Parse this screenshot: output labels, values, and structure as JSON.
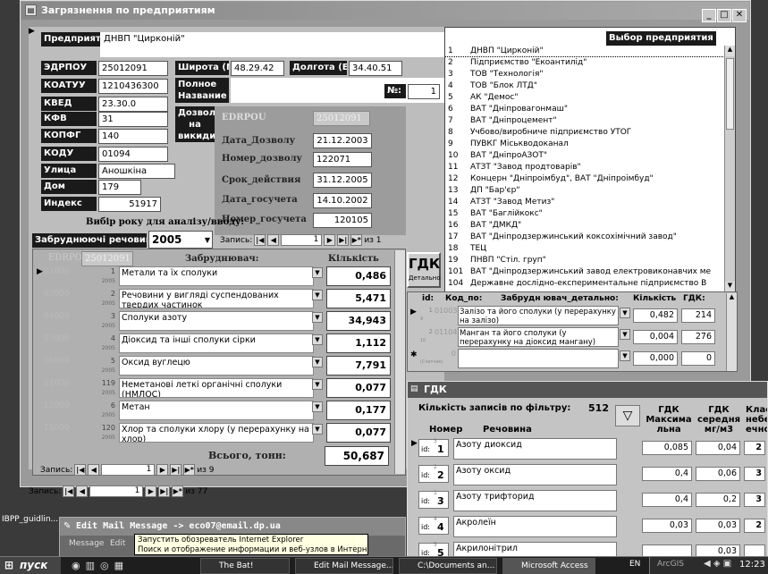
{
  "main_window": {
    "title": "Загрязнення по предприятиям"
  },
  "enterprise": {
    "label": "Предприятие",
    "value": "ДНВП \"Цирконій\""
  },
  "fields": {
    "edrpou": {
      "label": "ЭДРПОУ",
      "value": "25012091"
    },
    "koatuu": {
      "label": "КОАТУУ",
      "value": "1210436300"
    },
    "kved": {
      "label": "КВЕД",
      "value": "23.30.0"
    },
    "kfv": {
      "label": "КФВ",
      "value": "31"
    },
    "kopfg": {
      "label": "КОПФГ",
      "value": "140"
    },
    "kodu": {
      "label": "КОДУ",
      "value": "01094"
    },
    "street": {
      "label": "Улица",
      "value": "Аношкіна"
    },
    "house": {
      "label": "Дом",
      "value": "179"
    },
    "index": {
      "label": "Индекс",
      "value": "51917"
    },
    "lat": {
      "label": "Широта (N)",
      "value": "48.29.42"
    },
    "lon": {
      "label": "Долгота (E)",
      "value": "34.40.51"
    },
    "full_name": {
      "label": "Полное Название",
      "value": ""
    },
    "num": {
      "label": "№:",
      "value": "1"
    }
  },
  "permits": {
    "label": "Дозволи на викиди",
    "edrpou_label": "EDRPOU",
    "edrpou_value": "25012091",
    "date_label": "Дата_Дозволу",
    "date_value": "21.12.2003",
    "num_label": "Номер_дозволу",
    "num_value": "122071",
    "term_label": "Срок_действия",
    "term_value": "31.12.2005",
    "gos_date_label": "Дата_госучета",
    "gos_date_value": "14.10.2002",
    "gos_num_label": "Номер_госучета",
    "gos_num_value": "120105",
    "nav": {
      "label": "Запись:",
      "pos": "1",
      "total": "из 1"
    }
  },
  "year": {
    "label": "Вибір року для аналізу/вводу:",
    "value": "2005"
  },
  "pollutants": {
    "title": "Забруднюючі речовини",
    "edrpou_label": "EDRPOU",
    "edrpou_value": "25012091",
    "col_pollutant": "Забруднювач:",
    "col_qty": "Кількість",
    "rows": [
      {
        "code": "01000",
        "id": "1",
        "year": "2005",
        "name": "Метали та їх сполуки",
        "qty": "0,486"
      },
      {
        "code": "03000",
        "id": "2",
        "year": "2005",
        "name": "Речовини у вигляді суспендованих твердих частинок",
        "qty": "5,471"
      },
      {
        "code": "04000",
        "id": "3",
        "year": "2005",
        "name": "Сполуки азоту",
        "qty": "34,943"
      },
      {
        "code": "05000",
        "id": "4",
        "year": "2005",
        "name": "Діоксид та інші сполуки сірки",
        "qty": "1,112"
      },
      {
        "code": "06000",
        "id": "5",
        "year": "2005",
        "name": "Оксид вуглецю",
        "qty": "7,791"
      },
      {
        "code": "11000",
        "id": "119",
        "year": "2005",
        "name": "Неметанові леткі органічні сполуки (НМЛОС)",
        "qty": "0,077"
      },
      {
        "code": "12000",
        "id": "6",
        "year": "2005",
        "name": "Метан",
        "qty": "0,177"
      },
      {
        "code": "15000",
        "id": "120",
        "year": "2005",
        "name": "Хлор та сполуки хлору (у перерахунку на хлор)",
        "qty": "0,077"
      }
    ],
    "total_label": "Всього, тонн:",
    "total_value": "50,687",
    "nav": {
      "label": "Запись:",
      "pos": "1",
      "total": "из 9"
    }
  },
  "outer_nav": {
    "label": "Запись:",
    "pos": "1",
    "total": "из 77"
  },
  "enterprise_list": {
    "title": "Выбор предприятия",
    "items": [
      {
        "n": "1",
        "name": "ДНВП \"Цирконій\""
      },
      {
        "n": "2",
        "name": "Підприємство \"Екоантилід\""
      },
      {
        "n": "3",
        "name": "ТОВ \"Технологія\""
      },
      {
        "n": "4",
        "name": "ТОВ \"Блок ЛТД\""
      },
      {
        "n": "5",
        "name": "АК \"Демос\""
      },
      {
        "n": "6",
        "name": "ВАТ \"Дніпровагонмаш\""
      },
      {
        "n": "7",
        "name": "ВАТ \"Дніпроцемент\""
      },
      {
        "n": "8",
        "name": "Учбово/виробниче підприємство УТОГ"
      },
      {
        "n": "9",
        "name": "ПУВКГ Міськводоканал"
      },
      {
        "n": "10",
        "name": "ВАТ \"ДніпроАЗОТ\""
      },
      {
        "n": "11",
        "name": "АТЗТ \"Завод продтоварів\""
      },
      {
        "n": "12",
        "name": "Концерн \"Дніпроімбуд\", ВАТ \"Дніпроімбуд\""
      },
      {
        "n": "13",
        "name": "ДП \"Бар'єр\""
      },
      {
        "n": "14",
        "name": "АТЗТ \"Завод Метиз\""
      },
      {
        "n": "15",
        "name": "ВАТ \"Баглійкокс\""
      },
      {
        "n": "16",
        "name": "ВАТ \"ДМКД\""
      },
      {
        "n": "17",
        "name": "ВАТ \"Дніпродзержинський коксохімічний завод\""
      },
      {
        "n": "18",
        "name": "ТЕЦ"
      },
      {
        "n": "19",
        "name": "ПНВП \"Стіл. груп\""
      },
      {
        "n": "101",
        "name": "ВАТ \"Дніпродзержинський завод електровиконавчих ме"
      },
      {
        "n": "104",
        "name": "Державне дослідно-експериментальне підприємство В"
      }
    ]
  },
  "gdk_button": {
    "label": "ГДК",
    "sub": "Детально"
  },
  "detail": {
    "col_id": "id:",
    "col_code": "Код_по:",
    "col_pollutant": "Забрудн ювач_детально:",
    "col_qty": "Кількість",
    "col_gdk": "ГДК:",
    "rows": [
      {
        "id": "1",
        "sub": "9",
        "code": "01003",
        "name": "Залізо та його сполуки (у перерахунку на залізо)",
        "qty": "0,482",
        "gdk": "214"
      },
      {
        "id": "2",
        "sub": "10",
        "code": "01104",
        "name": "Манган та його сполуки (у перерахунку на діоксид мангану)",
        "qty": "0,004",
        "gdk": "276"
      },
      {
        "id": "",
        "sub": "(Счетчик)",
        "code": "0",
        "name": "",
        "qty": "0,000",
        "gdk": "0"
      }
    ]
  },
  "gdk_window": {
    "title": "ГДК",
    "count_label": "Кількість записів по фільтру:",
    "count_value": "512",
    "col_num": "Номер",
    "col_name": "Речовина",
    "col_max": "ГДК Максима льна",
    "col_avg": "ГДК середня мг/м3",
    "col_class": "Клас небезп ечності",
    "rows": [
      {
        "id": "id:",
        "sub": "3",
        "n": "1",
        "name": "Азоту диоксид",
        "max": "0,085",
        "avg": "0,04",
        "cls": "2"
      },
      {
        "id": "id:",
        "sub": "2",
        "n": "2",
        "name": "Азоту оксид",
        "max": "0,4",
        "avg": "0,06",
        "cls": "3"
      },
      {
        "id": "id:",
        "sub": "1",
        "n": "3",
        "name": "Азоту трифторид",
        "max": "0,4",
        "avg": "0,2",
        "cls": "3"
      },
      {
        "id": "id:",
        "sub": "4",
        "n": "4",
        "name": "Акролеїн",
        "max": "0,03",
        "avg": "0,03",
        "cls": "2"
      },
      {
        "id": "id:",
        "sub": "5",
        "n": "5",
        "name": "Акрилонітрил",
        "max": "",
        "avg": "0,03",
        "cls": ""
      }
    ]
  },
  "mail": {
    "title": "Edit Mail Message -> eco07@email.dp.ua",
    "menu": [
      "Message",
      "Edit"
    ]
  },
  "tooltip": {
    "line1": "Запустить обозреватель Internet Explorer",
    "line2": "Поиск и отображение информации и веб-узлов в Интернете."
  },
  "desktop_icon": {
    "label": "IBPP_guidlin..."
  },
  "taskbar": {
    "start": "пуск",
    "items": [
      "The Bat!",
      "Edit Mail Message...",
      "C:\\Documents an...",
      "Microsoft Access"
    ],
    "lang": "EN",
    "arcgis": "ArcGIS",
    "clock": "12:23"
  }
}
